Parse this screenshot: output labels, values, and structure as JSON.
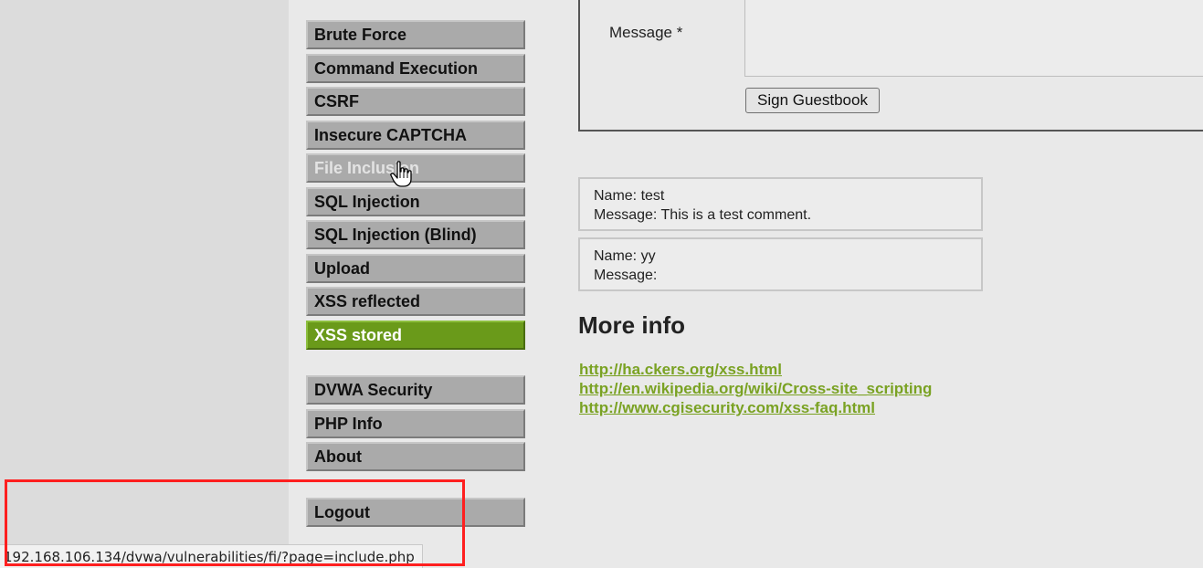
{
  "menu": {
    "items": [
      {
        "label": "Brute Force"
      },
      {
        "label": "Command Execution"
      },
      {
        "label": "CSRF"
      },
      {
        "label": "Insecure CAPTCHA"
      },
      {
        "label": "File Inclusion"
      },
      {
        "label": "SQL Injection"
      },
      {
        "label": "SQL Injection (Blind)"
      },
      {
        "label": "Upload"
      },
      {
        "label": "XSS reflected"
      },
      {
        "label": "XSS stored"
      }
    ],
    "secondary": [
      {
        "label": "DVWA Security"
      },
      {
        "label": "PHP Info"
      },
      {
        "label": "About"
      }
    ],
    "logout": "Logout",
    "selected_color": "#6a9a1a"
  },
  "form": {
    "message_label": "Message *",
    "message_value": "",
    "submit_label": "Sign Guestbook"
  },
  "guestbook": {
    "entries": [
      {
        "name": "Name: test",
        "message": "Message: This is a test comment."
      },
      {
        "name": "Name: yy",
        "message": "Message:"
      }
    ]
  },
  "more_info": {
    "title": "More info",
    "links": [
      "http://ha.ckers.org/xss.html",
      "http://en.wikipedia.org/wiki/Cross-site_scripting",
      "http://www.cgisecurity.com/xss-faq.html"
    ],
    "link_color": "#7aa223"
  },
  "statusbar": {
    "url": "192.168.106.134/dvwa/vulnerabilities/fi/?page=include.php"
  },
  "highlight_color": "#ff1f1f"
}
